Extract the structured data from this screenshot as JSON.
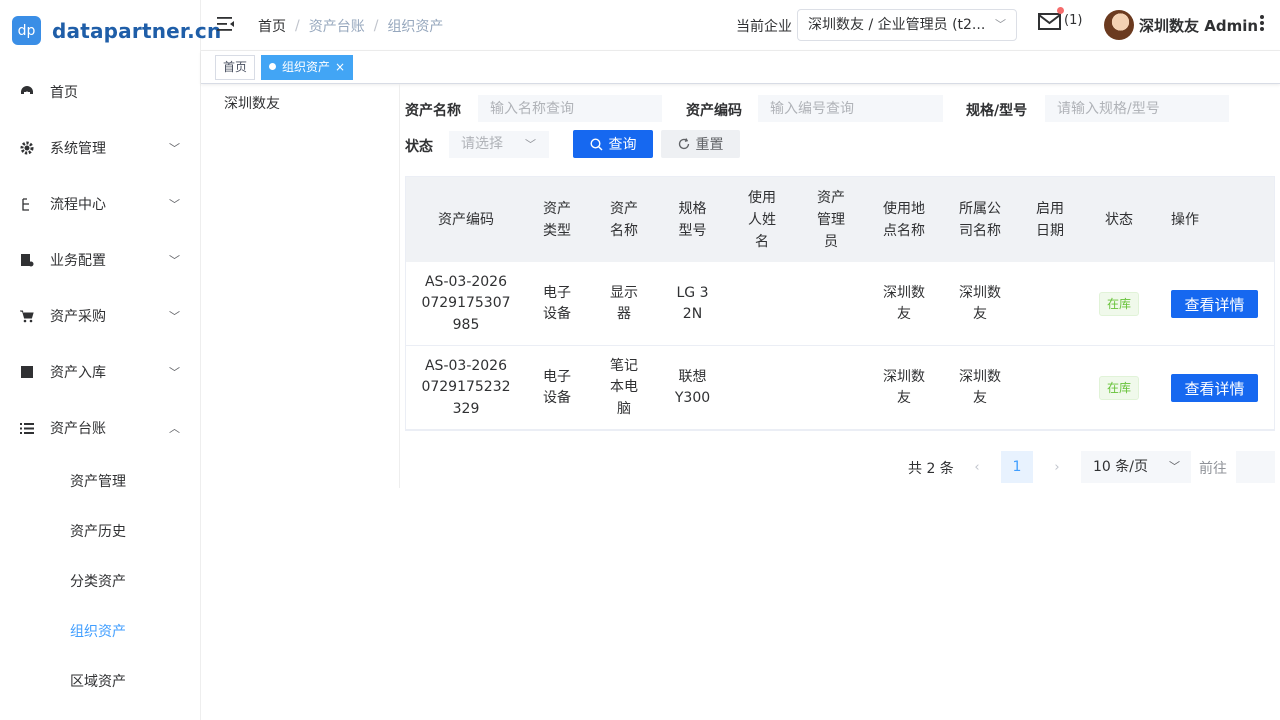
{
  "logo": {
    "badge": "dp",
    "text": "datapartner.cn"
  },
  "sidebar": {
    "items": [
      {
        "label": "首页",
        "icon": "dashboard-icon"
      },
      {
        "label": "系统管理",
        "icon": "gear-icon"
      },
      {
        "label": "流程中心",
        "icon": "flow-icon"
      },
      {
        "label": "业务配置",
        "icon": "business-icon"
      },
      {
        "label": "资产采购",
        "icon": "cart-icon"
      },
      {
        "label": "资产入库",
        "icon": "clapperboard-icon"
      },
      {
        "label": "资产台账",
        "icon": "list-icon"
      }
    ],
    "sub_items": [
      {
        "label": "资产管理"
      },
      {
        "label": "资产历史"
      },
      {
        "label": "分类资产"
      },
      {
        "label": "组织资产",
        "active": true
      },
      {
        "label": "区域资产"
      }
    ]
  },
  "header": {
    "breadcrumb": [
      "首页",
      "资产台账",
      "组织资产"
    ],
    "company_label": "当前企业",
    "company_value": "深圳数友 / 企业管理员 (t2...",
    "mail_count": "(1)",
    "user_name": "深圳数友 Admin"
  },
  "tags": [
    {
      "label": "首页"
    },
    {
      "label": "组织资产",
      "active": true,
      "close": "×"
    }
  ],
  "tree": {
    "root": "深圳数友"
  },
  "filters": {
    "asset_name_label": "资产名称",
    "asset_name_placeholder": "输入名称查询",
    "asset_code_label": "资产编码",
    "asset_code_placeholder": "输入编号查询",
    "spec_label": "规格/型号",
    "spec_placeholder": "请输入规格/型号",
    "status_label": "状态",
    "status_placeholder": "请选择",
    "search_button": "查询",
    "reset_button": "重置"
  },
  "table": {
    "headers": [
      "资产编码",
      "资产类型",
      "资产名称",
      "规格型号",
      "使用人姓名",
      "资产管理员",
      "使用地点名称",
      "所属公司名称",
      "启用日期",
      "状态",
      "操作"
    ],
    "rows": [
      {
        "code": "AS-03-20260729175307985",
        "type": "电子设备",
        "name": "显示器",
        "spec": "LG 32N",
        "user": "",
        "admin": "",
        "location": "深圳数友",
        "company": "深圳数友",
        "date": "",
        "status": "在库",
        "action": "查看详情"
      },
      {
        "code": "AS-03-20260729175232329",
        "type": "电子设备",
        "name": "笔记本电脑",
        "spec": "联想Y300",
        "user": "",
        "admin": "",
        "location": "深圳数友",
        "company": "深圳数友",
        "date": "",
        "status": "在库",
        "action": "查看详情"
      }
    ]
  },
  "pagination": {
    "total": "共 2 条",
    "prev": "‹",
    "current": "1",
    "next": "›",
    "page_size": "10 条/页",
    "goto": "前往"
  },
  "colors": {
    "primary": "#1668f0",
    "accent": "#409eff",
    "tag_active": "#42a5f5",
    "status_ok": "#67c23a"
  }
}
